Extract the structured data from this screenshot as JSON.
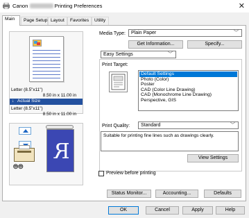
{
  "window": {
    "title_prefix": "Canon",
    "title_suffix": "Printing Preferences",
    "close_glyph": "✕"
  },
  "tabs": [
    {
      "label": "Main"
    },
    {
      "label": "Page Setup"
    },
    {
      "label": "Layout"
    },
    {
      "label": "Favorites"
    },
    {
      "label": "Utility"
    }
  ],
  "preview": {
    "paper_size_1": "Letter (8.5\"x11\")",
    "paper_dim_1": "8.50 in x 11.00 in",
    "actual_size_arrow": "↓",
    "actual_size_label": "Actual Size",
    "paper_size_2": "Letter (8.5\"x11\")",
    "paper_dim_2": "8.50 in x 11.00 in",
    "mirror_letter": "R",
    "icon_oo": "⦾⦾"
  },
  "media": {
    "label": "Media Type:",
    "value": "Plain Paper",
    "get_info_button": "Get Information...",
    "specify_button": "Specify..."
  },
  "easy_settings": {
    "value": "Easy Settings"
  },
  "print_target": {
    "label": "Print Target:",
    "items": [
      {
        "label": "Default Settings",
        "selected": true
      },
      {
        "label": "Photo (Color)",
        "selected": false
      },
      {
        "label": "Poster",
        "selected": false
      },
      {
        "label": "CAD (Color Line Drawing)",
        "selected": false
      },
      {
        "label": "CAD (Monochrome Line Drawing)",
        "selected": false
      },
      {
        "label": "Perspective, GIS",
        "selected": false
      }
    ]
  },
  "print_quality": {
    "label": "Print Quality:",
    "value": "Standard"
  },
  "description": "Suitable for printing fine lines such as drawings clearly.",
  "view_settings_button": "View Settings",
  "preview_before_printing": "Preview before printing",
  "footer_buttons": {
    "status_monitor": "Status Monitor...",
    "accounting": "Accounting...",
    "defaults": "Defaults"
  },
  "dialog_buttons": {
    "ok": "OK",
    "cancel": "Cancel",
    "apply": "Apply",
    "help": "Help"
  },
  "colors": {
    "accent_blue": "#23519f",
    "selection": "#0078d7"
  }
}
